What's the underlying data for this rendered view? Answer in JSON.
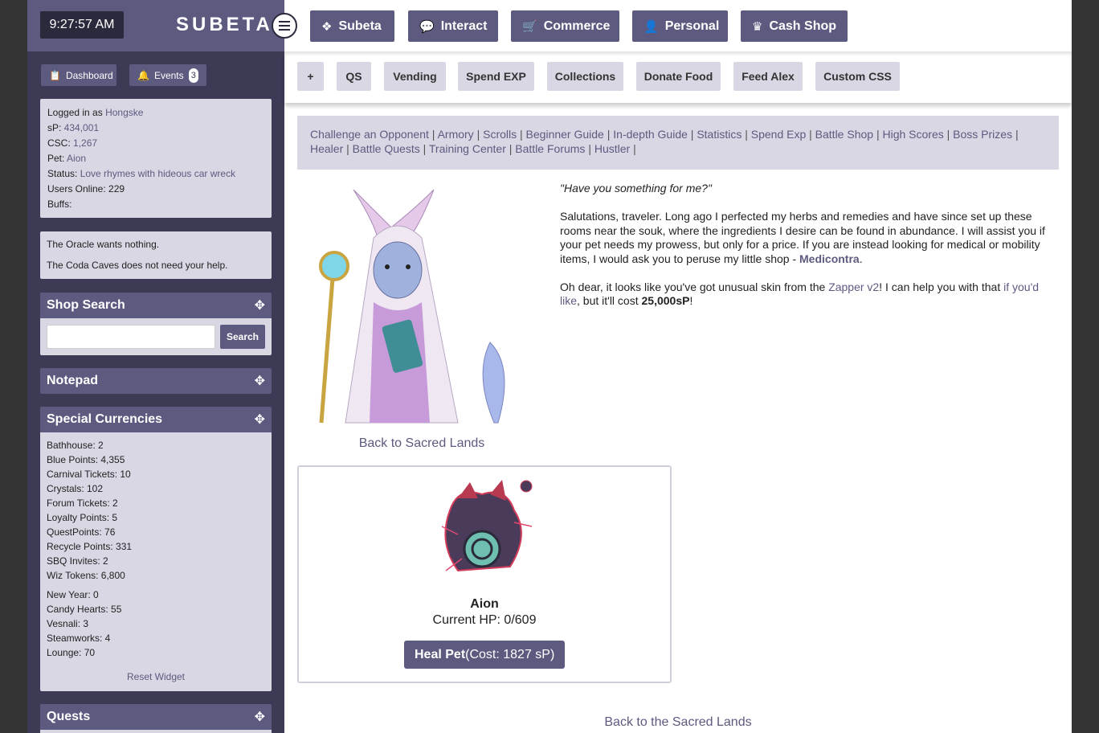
{
  "header": {
    "clock": "9:27:57 AM",
    "logo": "SUBETA"
  },
  "nav": [
    {
      "label": "Subeta",
      "icon": "compass-icon"
    },
    {
      "label": "Interact",
      "icon": "chat-icon"
    },
    {
      "label": "Commerce",
      "icon": "cart-icon"
    },
    {
      "label": "Personal",
      "icon": "user-icon"
    },
    {
      "label": "Cash Shop",
      "icon": "crown-icon"
    }
  ],
  "subnav": [
    "+",
    "QS",
    "Vending",
    "Spend EXP",
    "Collections",
    "Donate Food",
    "Feed Alex",
    "Custom CSS"
  ],
  "sidebar": {
    "dashboard_label": "Dashboard",
    "events_label": "Events",
    "events_count": "3",
    "user": {
      "logged_in_prefix": "Logged in as ",
      "username": "Hongske",
      "sp_label": "sP: ",
      "sp_value": "434,001",
      "csc_label": "CSC: ",
      "csc_value": "1,267",
      "pet_label": "Pet: ",
      "pet_value": "Aion",
      "status_label": "Status: ",
      "status_value": "Love rhymes with hideous car wreck",
      "users_online": "Users Online: 229",
      "buffs": "Buffs:"
    },
    "notices": [
      "The Oracle wants nothing.",
      "The Coda Caves does not need your help."
    ],
    "shop_search": {
      "title": "Shop Search",
      "placeholder": "",
      "button": "Search"
    },
    "notepad_title": "Notepad",
    "currencies": {
      "title": "Special Currencies",
      "group1": [
        "Bathhouse: 2",
        "Blue Points: 4,355",
        "Carnival Tickets: 10",
        "Crystals: 102",
        "Forum Tickets: 2",
        "Loyalty Points: 5",
        "QuestPoints: 76",
        "Recycle Points: 331",
        "SBQ Invites: 2",
        "Wiz Tokens: 6,800"
      ],
      "group2": [
        "New Year: 0",
        "Candy Hearts: 55",
        "Vesnali: 3",
        "Steamworks: 4",
        "Lounge: 70"
      ],
      "reset": "Reset Widget"
    },
    "quests_title": "Quests"
  },
  "battle_links": {
    "items": [
      "Challenge an Opponent",
      "Armory",
      "Scrolls",
      "Beginner Guide",
      "In-depth Guide",
      "Statistics",
      "Spend Exp",
      "Battle Shop",
      "High Scores",
      "Boss Prizes",
      "Healer",
      "Battle Quests",
      "Training Center",
      "Battle Forums",
      "Hustler"
    ]
  },
  "npc": {
    "back_link": "Back to Sacred Lands",
    "quote": "\"Have you something for me?\"",
    "para1": "Salutations, traveler. Long ago I perfected my herbs and remedies and have since set up these rooms near the souk, where the ingredients I desire can be found in abundance. I will assist you if your pet needs my prowess, but only for a price. If you are instead looking for medical or mobility items, I would ask you to peruse my little shop - ",
    "shop_link": "Medicontra",
    "para1_end": ".",
    "para2_a": "Oh dear, it looks like you've got unusual skin from the ",
    "zapper_link": "Zapper v2",
    "para2_b": "! I can help you with that ",
    "ifyoudlike_link": "if you'd like",
    "para2_c": ", but it'll cost ",
    "cost": "25,000sP",
    "para2_d": "!"
  },
  "pet": {
    "name": "Aion",
    "hp": "Current HP: 0/609",
    "heal_label": "Heal Pet",
    "heal_cost": " (Cost: 1827 sP)"
  },
  "footer_back": "Back to the Sacred Lands",
  "colors": {
    "accent": "#5d5a80",
    "sidebar": "#3c3a55",
    "panel": "#d8d7e3"
  }
}
